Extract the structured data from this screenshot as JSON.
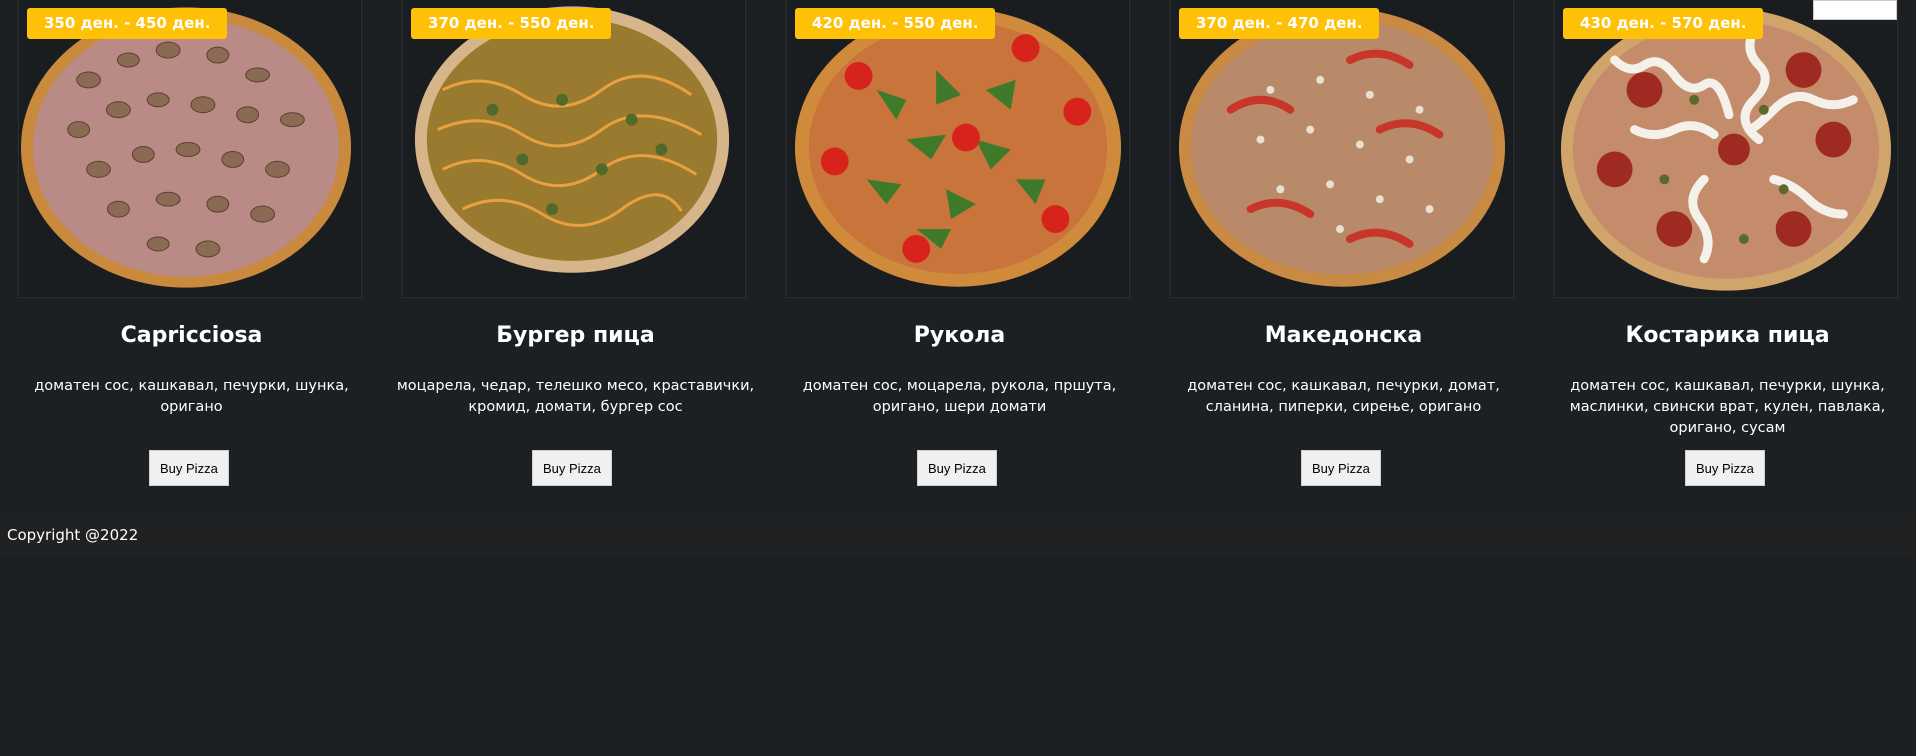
{
  "pizzas": [
    {
      "name": "Capricciosa",
      "price": "350 ден. - 450 ден.",
      "description": "доматен сос, кашкавал, печурки, шунка, оригано",
      "buy_label": "Buy Pizza"
    },
    {
      "name": "Бургер пица",
      "price": "370 ден. - 550 ден.",
      "description": "моцарела, чедар, телешко месо, краставички, кромид, домати, бургер сос",
      "buy_label": "Buy Pizza"
    },
    {
      "name": "Рукола",
      "price": "420 ден. - 550 ден.",
      "description": "доматен сос, моцарела, рукола, пршута, оригано, шери домати",
      "buy_label": "Buy Pizza"
    },
    {
      "name": "Македонска",
      "price": "370 ден. - 470 ден.",
      "description": "доматен сос, кашкавал, печурки, домат, сланина, пиперки, сирење, оригано",
      "buy_label": "Buy Pizza"
    },
    {
      "name": "Костарика пица",
      "price": "430 ден. - 570 ден.",
      "description": "доматен сос, кашкавал, печурки, шунка, маслинки, свински врат, кулен, павлака, оригано, сусам",
      "buy_label": "Buy Pizza"
    }
  ],
  "footer": {
    "copyright": "Copyright @2022"
  },
  "colors": {
    "background": "#1c2022",
    "badge": "#ffc107",
    "footer_bg": "#1f2123"
  }
}
